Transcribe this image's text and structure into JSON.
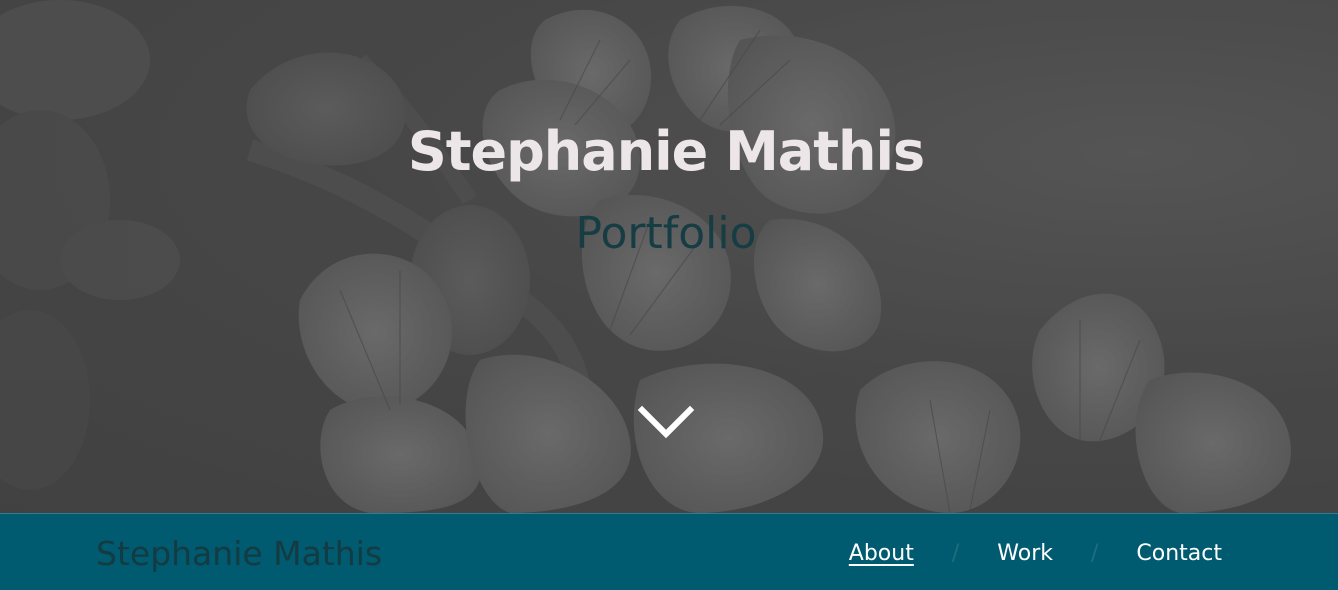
{
  "hero": {
    "title": "Stephanie Mathis",
    "subtitle": "Portfolio",
    "scroll_icon": "chevron-down-icon"
  },
  "navbar": {
    "brand": "Stephanie Mathis",
    "separator": "/",
    "links": [
      {
        "label": "About",
        "active": true
      },
      {
        "label": "Work",
        "active": false
      },
      {
        "label": "Contact",
        "active": false
      }
    ]
  },
  "colors": {
    "hero_title": "#ece6e9",
    "hero_subtitle": "#163c44",
    "navbar_bg": "#005b70",
    "brand": "#143a42",
    "nav_link": "#ffffff",
    "separator": "#1e6e80"
  }
}
